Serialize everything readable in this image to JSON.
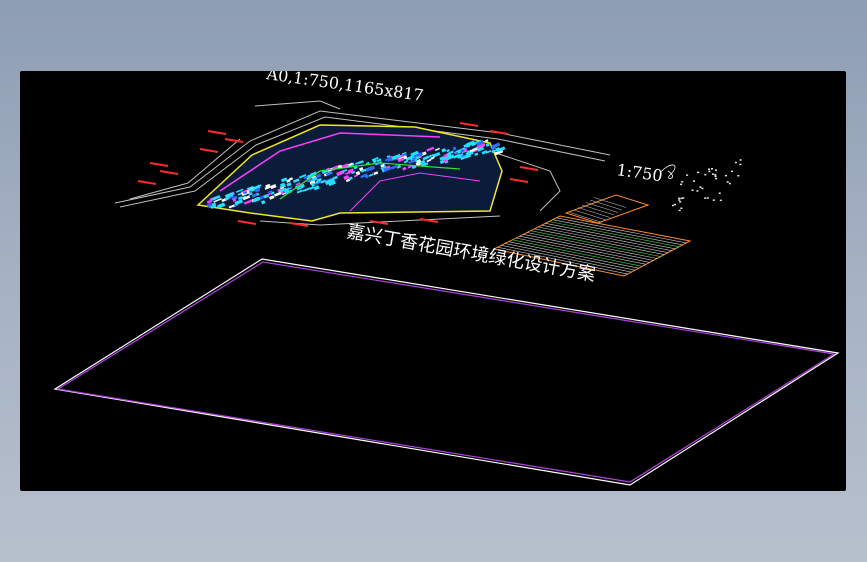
{
  "viewport": {
    "sheet_label": "A0,1:750,1165x817",
    "scale_label": "1:750",
    "drawing_title": "嘉兴丁香花园环境绿化设计方案"
  },
  "colors": {
    "background_top": "#8d9db3",
    "viewport": "#000000",
    "frame_outer": "#ffffff",
    "frame_inner": "#b042e0",
    "plan_cyan": "#22e0ff",
    "plan_magenta": "#ff3cff",
    "plan_yellow": "#f4e62a",
    "plan_green": "#35e03a",
    "plan_red": "#ff2a2a",
    "table_orange": "#ff8a2a"
  }
}
